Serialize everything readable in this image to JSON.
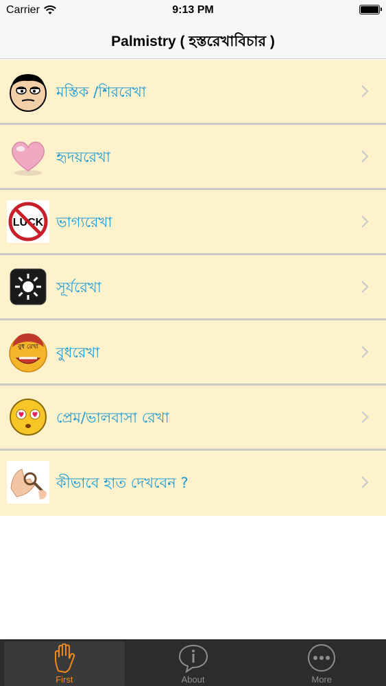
{
  "status_bar": {
    "carrier": "Carrier",
    "time": "9:13 PM"
  },
  "nav": {
    "title": "Palmistry ( হস্তরেখাবিচার )"
  },
  "list": [
    {
      "label": "মস্তিক /শিররেখা",
      "icon": "face-icon"
    },
    {
      "label": "হৃদয়রেখা",
      "icon": "heart-icon"
    },
    {
      "label": "ভাগ্যরেখা",
      "icon": "no-luck-icon",
      "icon_text": "LUCK"
    },
    {
      "label": "সূর্যরেখা",
      "icon": "sun-icon"
    },
    {
      "label": "বুধরেখা",
      "icon": "budh-face-icon",
      "icon_text": "বুধ রেখা"
    },
    {
      "label": "প্রেম/ভালবাসা রেখা",
      "icon": "love-emoji-icon"
    },
    {
      "label": "কীভাবে হাত দেখবেন ?",
      "icon": "palm-magnifier-icon"
    }
  ],
  "tabs": [
    {
      "label": "First",
      "icon": "hand-icon",
      "active": true
    },
    {
      "label": "About",
      "icon": "info-bubble-icon",
      "active": false
    },
    {
      "label": "More",
      "icon": "more-dots-icon",
      "active": false
    }
  ],
  "colors": {
    "row_bg": "#fdf2cb",
    "label": "#1d9bd6",
    "active_tab": "#f08a1c",
    "tab_bar": "#2c2c2c"
  }
}
